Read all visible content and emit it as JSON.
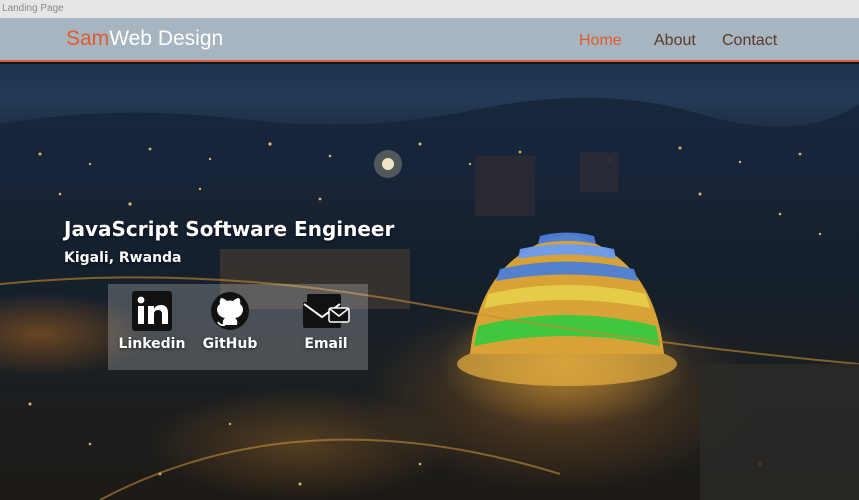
{
  "window": {
    "title": "Landing Page"
  },
  "navbar": {
    "brand_accent": "Sam",
    "brand_rest": "Web Design",
    "links": [
      {
        "label": "Home",
        "active": true
      },
      {
        "label": "About",
        "active": false
      },
      {
        "label": "Contact",
        "active": false
      }
    ]
  },
  "hero": {
    "headline": "JavaScript Software Engineer",
    "location": "Kigali, Rwanda",
    "background": "night-city-aerial-image"
  },
  "social": [
    {
      "label": "Linkedin",
      "icon": "linkedin-icon"
    },
    {
      "label": "GitHub",
      "icon": "github-icon"
    },
    {
      "label": "Email",
      "icon": "email-icon"
    }
  ],
  "colors": {
    "accent": "#e05a2b",
    "navbar": "#a7b5c0",
    "nav_text": "#5a3a2a"
  }
}
